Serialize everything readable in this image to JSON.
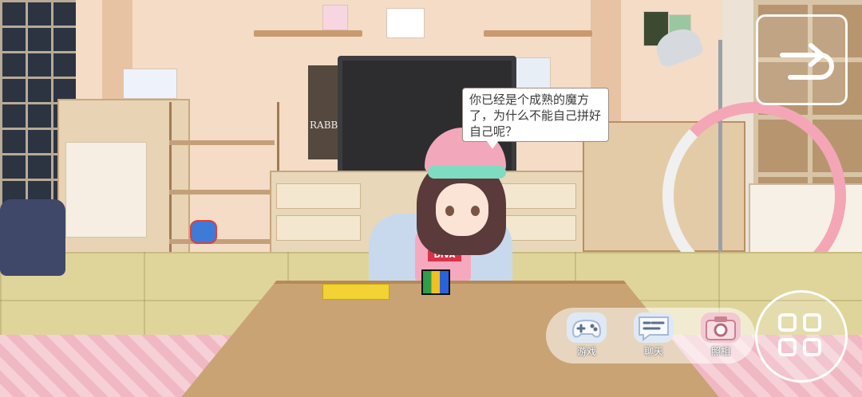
{
  "dialogue": {
    "text": "你已经是个成熟的魔方了，为什么不能自己拼好自己呢？"
  },
  "character": {
    "shirt_text": "DIVA"
  },
  "scene": {
    "poster_text": "RABBI"
  },
  "controls": {
    "back_button_icon": "return-arrow-icon",
    "menu_button_icon": "grid-menu-icon"
  },
  "dock": {
    "items": [
      {
        "label": "游戏",
        "icon": "gamepad-icon"
      },
      {
        "label": "聊天",
        "icon": "chat-bubble-icon"
      },
      {
        "label": "照相",
        "icon": "camera-icon"
      }
    ]
  },
  "colors": {
    "accent_pink": "#f4a6b6",
    "mint": "#7fdcc2",
    "dock_icon_blue": "#dfe9f6"
  }
}
